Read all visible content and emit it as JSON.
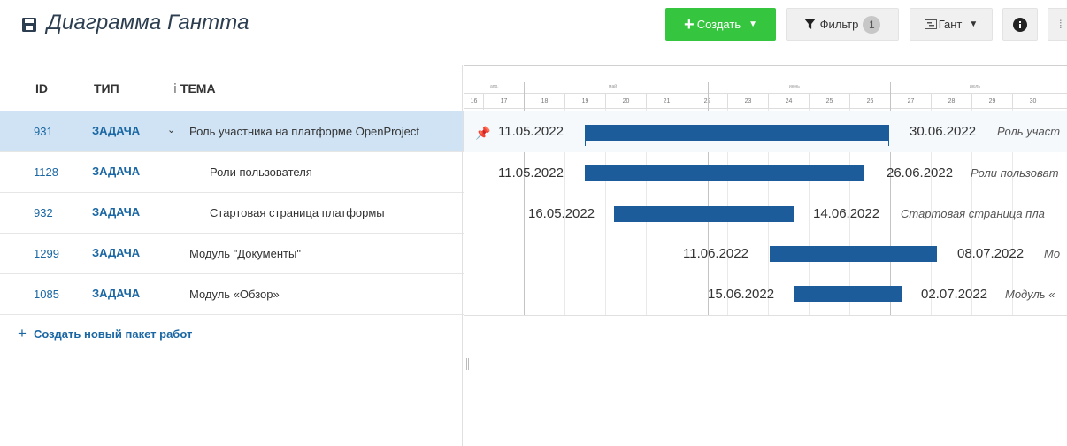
{
  "header": {
    "title": "Диаграмма Гантта",
    "create_button": "Создать",
    "filter_button": "Фильтр",
    "filter_count": "1",
    "gantt_button": "Гант",
    "info_icon": "info-icon",
    "save_icon": "save-icon"
  },
  "table": {
    "columns": [
      "ID",
      "ТИП",
      "ТЕМА"
    ],
    "rows": [
      {
        "id": "931",
        "type": "ЗАДАЧА",
        "subject": "Роль участника на платформе OpenProject",
        "selected": true,
        "expanded": true
      },
      {
        "id": "1128",
        "type": "ЗАДАЧА",
        "subject": "Роли пользователя"
      },
      {
        "id": "932",
        "type": "ЗАДАЧА",
        "subject": "Стартовая страница платформы"
      },
      {
        "id": "1299",
        "type": "ЗАДАЧА",
        "subject": "Модуль \"Документы\""
      },
      {
        "id": "1085",
        "type": "ЗАДАЧА",
        "subject": "Модуль «Обзор»"
      }
    ],
    "create_link": "Создать новый пакет работ"
  },
  "gantt": {
    "months": [
      "апр.",
      "май",
      "июнь",
      "июль"
    ],
    "days": [
      "16",
      "17",
      "18",
      "19",
      "20",
      "21",
      "22",
      "23",
      "24",
      "25",
      "26",
      "27",
      "28",
      "29",
      "30"
    ],
    "bars": [
      {
        "start": "11.05.2022",
        "end": "30.06.2022",
        "label": "Роль участ"
      },
      {
        "start": "11.05.2022",
        "end": "26.06.2022",
        "label": "Роли пользоват"
      },
      {
        "start": "16.05.2022",
        "end": "14.06.2022",
        "label": "Стартовая страница пла"
      },
      {
        "start": "11.06.2022",
        "end": "08.07.2022",
        "label": "Мо"
      },
      {
        "start": "15.06.2022",
        "end": "02.07.2022",
        "label": "Модуль «"
      }
    ],
    "colors": {
      "bar": "#1d5c9b",
      "today_line": "#e33333",
      "create_button": "#35c53f"
    }
  }
}
